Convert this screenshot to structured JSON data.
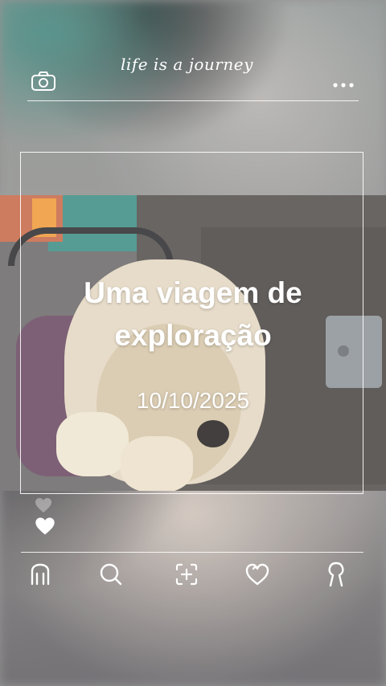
{
  "header": {
    "title": "life is a journey",
    "camera_icon": "camera-icon",
    "more_icon": "more-dots-icon"
  },
  "post": {
    "title": "Uma viagem de exploração",
    "date": "10/10/2025"
  },
  "likes": {
    "small_icon": "heart-outline-icon",
    "big_icon": "heart-filled-icon"
  },
  "bottom_nav": {
    "items": [
      {
        "icon": "home-icon"
      },
      {
        "icon": "search-icon"
      },
      {
        "icon": "add-photo-icon"
      },
      {
        "icon": "heart-icon"
      },
      {
        "icon": "profile-icon"
      }
    ]
  },
  "colors": {
    "foreground": "#ffffff"
  }
}
